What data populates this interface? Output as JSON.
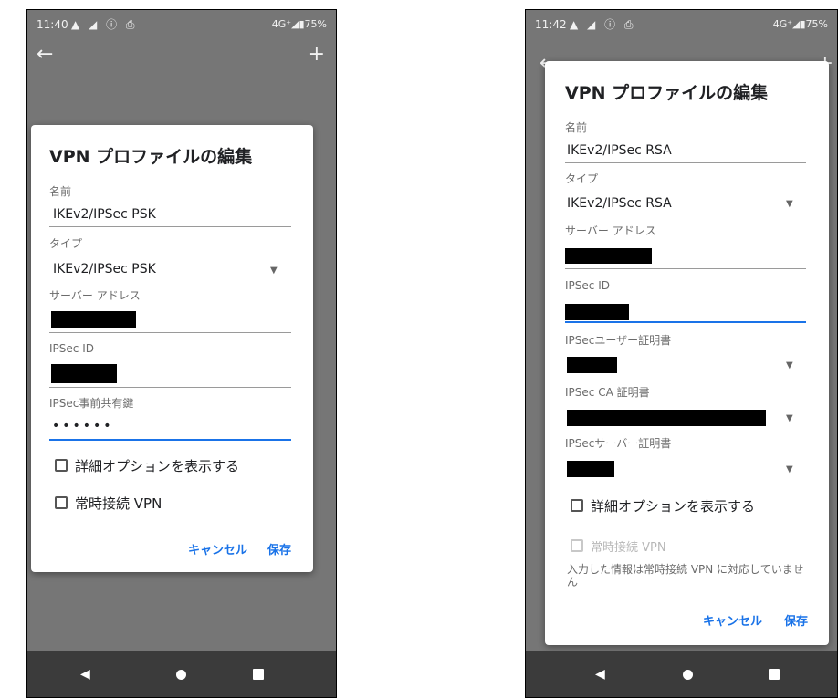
{
  "left": {
    "status": {
      "time": "11:40",
      "icons": "▲ ◢ ⓘ ⎙",
      "right": "4G⁺◢▮75%"
    },
    "appbar": {
      "back_icon": "←",
      "add_icon": "+"
    },
    "dialog": {
      "title": "VPN プロファイルの編集",
      "name_label": "名前",
      "name_value": "IKEv2/IPSec PSK",
      "type_label": "タイプ",
      "type_value": "IKEv2/IPSec PSK",
      "server_label": "サーバー アドレス",
      "ipsec_id_label": "IPSec ID",
      "psk_label": "IPSec事前共有鍵",
      "psk_value": "••••••",
      "advanced_label": "詳細オプションを表示する",
      "always_on_label": "常時接続 VPN",
      "cancel": "キャンセル",
      "save": "保存"
    }
  },
  "right": {
    "status": {
      "time": "11:42",
      "icons": "▲ ◢ ⓘ ⎙",
      "right": "4G⁺◢▮75%"
    },
    "appbar": {
      "back_icon": "←",
      "add_icon": "+"
    },
    "dialog": {
      "title": "VPN プロファイルの編集",
      "name_label": "名前",
      "name_value": "IKEv2/IPSec RSA",
      "type_label": "タイプ",
      "type_value": "IKEv2/IPSec RSA",
      "server_label": "サーバー アドレス",
      "ipsec_id_label": "IPSec ID",
      "user_cert_label": "IPSecユーザー証明書",
      "ca_cert_label": "IPSec CA 証明書",
      "server_cert_label": "IPSecサーバー証明書",
      "advanced_label": "詳細オプションを表示する",
      "always_on_label": "常時接続 VPN",
      "note": "入力した情報は常時接続 VPN に対応していません",
      "cancel": "キャンセル",
      "save": "保存"
    }
  },
  "icons": {
    "back": "back-arrow-icon",
    "home": "home-icon",
    "recents": "recents-icon",
    "dropdown": "dropdown-arrow-icon"
  }
}
